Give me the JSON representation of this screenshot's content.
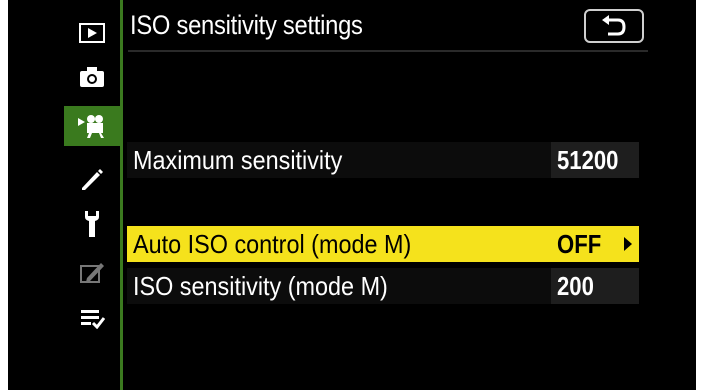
{
  "header": {
    "title": "ISO sensitivity settings"
  },
  "sidebar": {
    "items": [
      {
        "icon": "playback-icon"
      },
      {
        "icon": "photo-shooting-icon"
      },
      {
        "icon": "movie-shooting-icon",
        "active": true
      },
      {
        "icon": "custom-settings-pencil-icon"
      },
      {
        "icon": "setup-wrench-icon"
      },
      {
        "icon": "retouch-icon"
      },
      {
        "icon": "my-menu-icon"
      }
    ]
  },
  "menu": {
    "rows": [
      {
        "label": "Maximum sensitivity",
        "value": "51200"
      },
      {
        "label": "Auto ISO control (mode M)",
        "value": "OFF",
        "selected": true
      },
      {
        "label": "ISO sensitivity (mode M)",
        "value": "200"
      }
    ]
  },
  "colors": {
    "highlight": "#f5e21c",
    "active_tab": "#3a7a1e"
  }
}
